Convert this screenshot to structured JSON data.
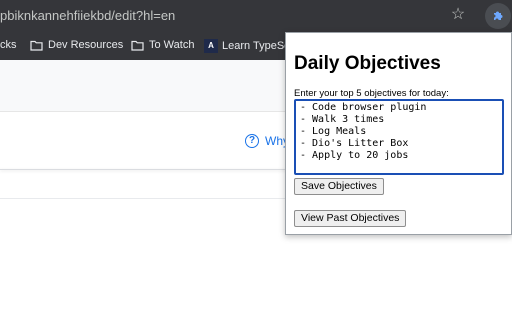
{
  "browser": {
    "url": "pbiknkannehfiiekbd/edit?hl=en",
    "bookmarks": [
      {
        "label": "cks"
      },
      {
        "label": "Dev Resources"
      },
      {
        "label": "To Watch"
      },
      {
        "label": "Learn TypeScr",
        "badge": "A"
      }
    ]
  },
  "page": {
    "help_text": "Why"
  },
  "popup": {
    "title": "Daily Objectives",
    "prompt": "Enter your top 5 objectives for today:",
    "objectives": "- Code browser plugin\n- Walk 3 times\n- Log Meals\n- Dio's Litter Box\n- Apply to 20 jobs",
    "save_label": "Save Objectives",
    "past_label": "View Past Objectives"
  },
  "colors": {
    "chrome": "#35363a",
    "extension_accent": "#1a73e8",
    "textarea_border": "#1a4fb5"
  }
}
